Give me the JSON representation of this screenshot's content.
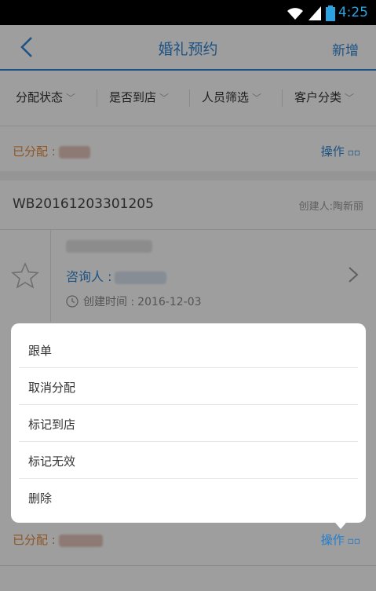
{
  "status_bar": {
    "time": "4:25"
  },
  "header": {
    "title": "婚礼预约",
    "add_label": "新增"
  },
  "filters": [
    {
      "label": "分配状态"
    },
    {
      "label": "是否到店"
    },
    {
      "label": "人员筛选"
    },
    {
      "label": "客户分类"
    }
  ],
  "cards": [
    {
      "status_label": "已分配 :",
      "ops_label": "操作"
    },
    {
      "order_no": "WB20161203301205",
      "creator": "创建人:陶新丽",
      "customer_label": "咨询人 :",
      "created_time_label": "创建时间 :",
      "created_date": "2016-12-03"
    },
    {
      "status_label": "已分配 :",
      "ops_label": "操作"
    }
  ],
  "action_menu": {
    "items": [
      "跟单",
      "取消分配",
      "标记到店",
      "标记无效",
      "删除"
    ]
  },
  "colors": {
    "accent": "#2f86d4",
    "assigned": "#e58a3c"
  }
}
